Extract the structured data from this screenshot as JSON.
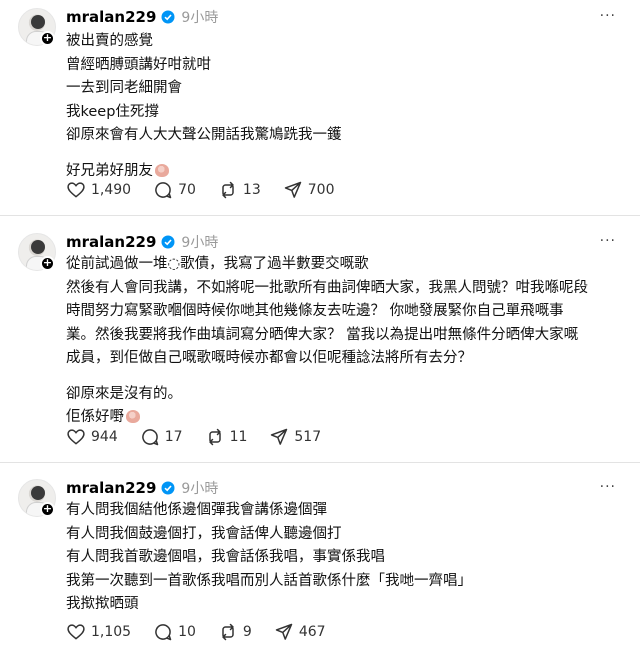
{
  "posts": [
    {
      "username": "mralan229",
      "time": "9小時",
      "more": "···",
      "lines": [
        "被出賣的感覺",
        "曾經晒膊頭講好咁就咁",
        "一去到同老細開會",
        "我keep住死撐",
        "卻原來會有人大大聲公開話我驚鳩跣我一鑊"
      ],
      "extra_lines": [
        "好兄弟好朋友"
      ],
      "likes": "1,490",
      "comments": "70",
      "reposts": "13",
      "shares": "700"
    },
    {
      "username": "mralan229",
      "time": "9小時",
      "more": "···",
      "lines": [
        "從前試過做一堆◌歌債，我寫了過半數要交嘅歌",
        "然後有人會同我講，不如將呢一批歌所有曲詞俾晒大家，我黑人問號？咁我喺呢段",
        "時間努力寫緊歌嗰個時候你哋其他幾條友去咗邊？ 你哋發展緊你自己單飛嘅事",
        "業。然後我要將我作曲填詞寫分晒俾大家？ 當我以為提出咁無條件分晒俾大家嘅",
        "成員，到佢做自己嘅歌嘅時候亦都會以佢呢種諗法將所有去分？"
      ],
      "extra_lines": [
        "卻原來是沒有的。",
        "佢係好嘢"
      ],
      "likes": "944",
      "comments": "17",
      "reposts": "11",
      "shares": "517"
    },
    {
      "username": "mralan229",
      "time": "9小時",
      "more": "···",
      "lines": [
        "有人問我個結他係邊個彈我會講係邊個彈",
        "有人問我個鼓邊個打，我會話俾人聽邊個打",
        "有人問我首歌邊個唱，我會話係我唱，事實係我唱",
        "我第一次聽到一首歌係我唱而別人話首歌係什麼「我哋一齊唱」",
        "我揿揿晒頭"
      ],
      "extra_lines": [],
      "likes": "1,105",
      "comments": "10",
      "reposts": "9",
      "shares": "467"
    }
  ]
}
